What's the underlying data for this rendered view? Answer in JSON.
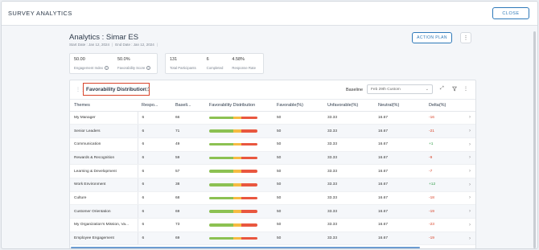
{
  "header": {
    "title": "SURVEY ANALYTICS",
    "close_label": "CLOSE"
  },
  "page": {
    "title": "Analytics : Simar ES",
    "start_date": "Start Date : Jan 12, 2024",
    "end_date": "End Date : Jan 12, 2024",
    "action_plan_label": "ACTION PLAN"
  },
  "stats_a": [
    {
      "value": "50.00",
      "label": "Engagement Index"
    },
    {
      "value": "50.0%",
      "label": "Favorability Score"
    }
  ],
  "stats_b": [
    {
      "value": "131",
      "label": "Total Participants"
    },
    {
      "value": "6",
      "label": "Completed"
    },
    {
      "value": "4.58%",
      "label": "Response Rate"
    }
  ],
  "card": {
    "title": "Favorability Distribution",
    "baseline_label": "Baseline",
    "baseline_value": "Feb 29th Custom"
  },
  "table": {
    "columns": [
      "Themes",
      "Respo...",
      "Baseli...",
      "Favorability Distribution",
      "Favorable(%)",
      "Unfavorable(%)",
      "Neutral(%)",
      "Delta(%)"
    ],
    "rows": [
      {
        "theme": "My Manager",
        "resp": "6",
        "base": "66",
        "fav": "50",
        "unfav": "33.33",
        "neutral": "16.67",
        "delta": "-16"
      },
      {
        "theme": "Senior Leaders",
        "resp": "6",
        "base": "71",
        "fav": "50",
        "unfav": "33.33",
        "neutral": "16.67",
        "delta": "-21"
      },
      {
        "theme": "Communication",
        "resp": "6",
        "base": "49",
        "fav": "50",
        "unfav": "33.33",
        "neutral": "16.67",
        "delta": "+1"
      },
      {
        "theme": "Rewards & Recognition",
        "resp": "6",
        "base": "59",
        "fav": "50",
        "unfav": "33.33",
        "neutral": "16.67",
        "delta": "-9"
      },
      {
        "theme": "Learning & Development",
        "resp": "6",
        "base": "57",
        "fav": "50",
        "unfav": "33.33",
        "neutral": "16.67",
        "delta": "-7"
      },
      {
        "theme": "Work Environment",
        "resp": "6",
        "base": "38",
        "fav": "50",
        "unfav": "33.33",
        "neutral": "16.67",
        "delta": "+12"
      },
      {
        "theme": "Culture",
        "resp": "6",
        "base": "68",
        "fav": "50",
        "unfav": "33.33",
        "neutral": "16.67",
        "delta": "-18"
      },
      {
        "theme": "Customer Orientation",
        "resp": "6",
        "base": "69",
        "fav": "50",
        "unfav": "33.33",
        "neutral": "16.67",
        "delta": "-19"
      },
      {
        "theme": "My Organization's Mission, Va...",
        "resp": "6",
        "base": "73",
        "fav": "50",
        "unfav": "33.33",
        "neutral": "16.67",
        "delta": "-23"
      },
      {
        "theme": "Employee Engagement",
        "resp": "6",
        "base": "69",
        "fav": "50",
        "unfav": "33.33",
        "neutral": "16.67",
        "delta": "-19"
      }
    ]
  },
  "colors": {
    "favorable": "#8cc152",
    "neutral": "#f6bb42",
    "unfavorable": "#e9573f",
    "accent": "#2e79b9",
    "highlight": "#d9442a"
  }
}
